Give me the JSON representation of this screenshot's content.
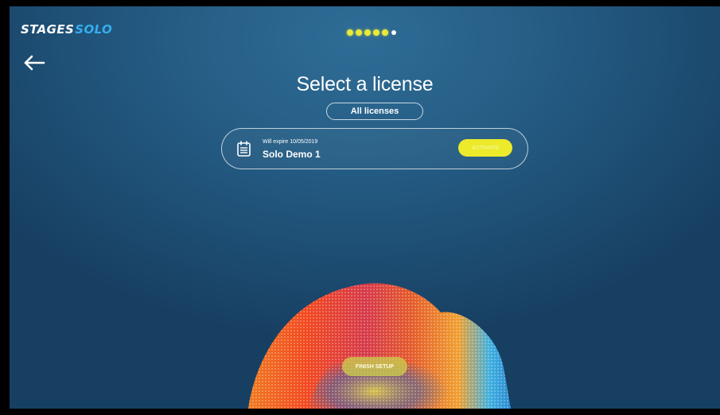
{
  "brand": {
    "part1": "STAGES",
    "part2": "SOLO"
  },
  "progress": {
    "completed_steps": 5,
    "total_steps": 6
  },
  "page": {
    "title": "Select a license"
  },
  "filter": {
    "label": "All licenses"
  },
  "license_card": {
    "expiry_text": "Will expire 10/05/2019",
    "name": "Solo Demo 1",
    "action_label": "ACTIVATE"
  },
  "footer": {
    "finish_label": "FINISH SETUP"
  },
  "icons": {
    "back": "arrow-left-icon",
    "license": "calendar-icon"
  },
  "colors": {
    "accent_yellow": "#ecea2a",
    "brand_blue": "#35aef0",
    "background": "#245b83"
  }
}
